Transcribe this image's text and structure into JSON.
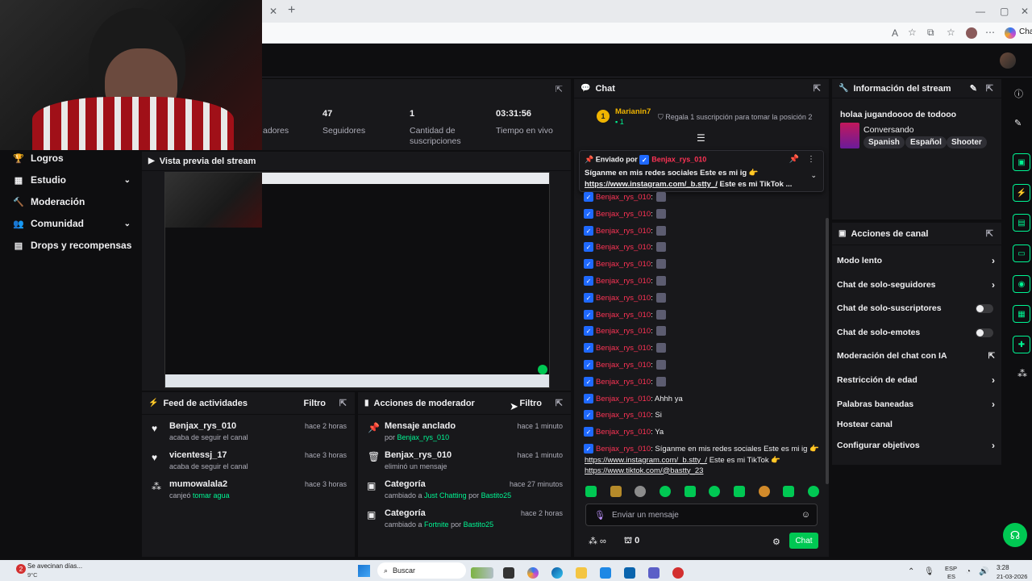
{
  "browser": {
    "close_tab": "✕",
    "new_tab": "+",
    "window_controls": [
      "—",
      "▢",
      "✕"
    ],
    "copilot_label": "Chat"
  },
  "sidebar": {
    "items": [
      {
        "label": "Logros",
        "icon": "trophy-icon",
        "expandable": false
      },
      {
        "label": "Estudio",
        "icon": "studio-icon",
        "expandable": true
      },
      {
        "label": "Moderación",
        "icon": "moderation-icon",
        "expandable": false
      },
      {
        "label": "Comunidad",
        "icon": "community-icon",
        "expandable": true
      },
      {
        "label": "Drops y recompensas",
        "icon": "drops-icon",
        "expandable": false
      }
    ]
  },
  "stats": {
    "items": [
      {
        "value": "",
        "label": "adores"
      },
      {
        "value": "47",
        "label": "Seguidores"
      },
      {
        "value": "1",
        "label": "Cantidad de suscripciones"
      },
      {
        "value": "03:31:56",
        "label": "Tiempo en vivo"
      }
    ]
  },
  "preview": {
    "title": "Vista previa del stream"
  },
  "activity_feed": {
    "title": "Feed de actividades",
    "filter": "Filtro",
    "items": [
      {
        "user": "Benjax_rys_010",
        "action": "acaba de seguir el canal",
        "time": "hace 2 horas",
        "icon": "heart-icon"
      },
      {
        "user": "vicentessj_17",
        "action": "acaba de seguir el canal",
        "time": "hace 3 horas",
        "icon": "heart-icon"
      },
      {
        "user": "mumowalala2",
        "action": "canjeó",
        "highlight": "tomar agua",
        "time": "hace 3 horas",
        "icon": "points-icon"
      }
    ]
  },
  "mod_actions": {
    "title": "Acciones de moderador",
    "filter": "Filtro",
    "items": [
      {
        "title": "Mensaje anclado",
        "sub": "por",
        "highlight": "Benjax_rys_010",
        "time": "hace 1 minuto",
        "icon": "pin-icon"
      },
      {
        "title": "Benjax_rys_010",
        "sub": "eliminó un mensaje",
        "time": "hace 1 minuto",
        "icon": "trash-icon"
      },
      {
        "title": "Categoría",
        "sub": "cambiado a",
        "highlight": "Just Chatting",
        "sub2": "por",
        "highlight2": "Bastito25",
        "time": "hace 27 minutos",
        "icon": "category-icon"
      },
      {
        "title": "Categoría",
        "sub": "cambiado a",
        "highlight": "Fortnite",
        "sub2": "por",
        "highlight2": "Bastito25",
        "time": "hace 2 horas",
        "icon": "category-icon"
      }
    ]
  },
  "chat": {
    "title": "Chat",
    "gifter": {
      "rank": "1",
      "name": "Marianin7",
      "count": "1"
    },
    "gift_cta": "Regala 1 suscripción para tomar la posición 2",
    "pinned": {
      "label": "Enviado por",
      "user": "Benjax_rys_010",
      "text": "Síganme en mis redes sociales Este es mi ig 👉",
      "link": "https://www.instagram.com/_b.stty_/",
      "rest": "Este es mi TikTok ..."
    },
    "messages": [
      {
        "user": "Benjax_rys_010",
        "text": ":"
      },
      {
        "user": "Benjax_rys_010",
        "text": ":"
      },
      {
        "user": "Benjax_rys_010",
        "text": ":"
      },
      {
        "user": "Benjax_rys_010",
        "text": ":"
      },
      {
        "user": "Benjax_rys_010",
        "text": ":"
      },
      {
        "user": "Benjax_rys_010",
        "text": ":"
      },
      {
        "user": "Benjax_rys_010",
        "text": ":"
      },
      {
        "user": "Benjax_rys_010",
        "text": ":"
      },
      {
        "user": "Benjax_rys_010",
        "text": ":"
      },
      {
        "user": "Benjax_rys_010",
        "text": ":"
      },
      {
        "user": "Benjax_rys_010",
        "text": ":"
      },
      {
        "user": "Benjax_rys_010",
        "text": ":"
      },
      {
        "user": "Benjax_rys_010",
        "text": ": Ahhh ya"
      },
      {
        "user": "Benjax_rys_010",
        "text": ": Si"
      },
      {
        "user": "Benjax_rys_010",
        "text": ": Ya"
      }
    ],
    "last_message": {
      "user": "Benjax_rys_010",
      "text": ": Síganme en mis redes sociales Este es mi ig 👉",
      "link1": "https://www.instagram.com/_b.stty_/",
      "mid": "Este es mi TikTok 👉",
      "link2": "https://www.tiktok.com/@bastty_23"
    },
    "input_placeholder": "Enviar un mensaje",
    "points": "0",
    "send_label": "Chat"
  },
  "stream_info": {
    "title": "Información del stream",
    "stream_title": "holaa jugandoooo de todooo",
    "category": "Conversando",
    "tags": [
      "Spanish",
      "Español",
      "Shooter"
    ]
  },
  "channel_actions": {
    "title": "Acciones de canal",
    "items": [
      {
        "label": "Modo lento",
        "control": "chevron"
      },
      {
        "label": "Chat de solo-seguidores",
        "control": "chevron"
      },
      {
        "label": "Chat de solo-suscriptores",
        "control": "toggle"
      },
      {
        "label": "Chat de solo-emotes",
        "control": "toggle"
      },
      {
        "label": "Moderación del chat con IA",
        "control": "external"
      },
      {
        "label": "Restricción de edad",
        "control": "chevron"
      },
      {
        "label": "Palabras baneadas",
        "control": "chevron"
      },
      {
        "label": "Hostear canal",
        "control": "none"
      },
      {
        "label": "Configurar objetivos",
        "control": "chevron"
      }
    ]
  },
  "taskbar": {
    "weather_title": "Se avecinan días...",
    "weather_temp": "9°C",
    "search": "Buscar",
    "lang": "ESP",
    "lang2": "ES",
    "time": "3:28",
    "date": "21-03-2026"
  },
  "colors": {
    "accent": "#00f593",
    "username": "#ff3355",
    "panel": "#18181b",
    "bg": "#0e0e10"
  }
}
